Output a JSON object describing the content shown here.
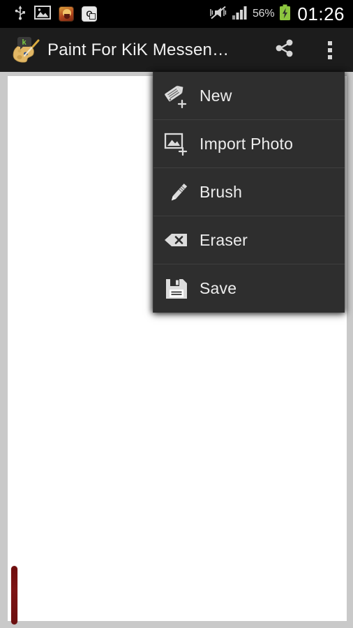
{
  "status_bar": {
    "left_icons": [
      {
        "name": "usb-icon",
        "label": "USB connected"
      },
      {
        "name": "gallery-icon",
        "label": "Screenshot captured"
      },
      {
        "name": "clash-of-clans-notification-icon",
        "label": "Clash of Clans"
      },
      {
        "name": "outlook-notification-icon",
        "label": "Outlook",
        "letter": "O"
      }
    ],
    "vibrate_icon": "vibrate-muted-icon",
    "signal_icon": "signal-bars-icon",
    "battery_percent": "56%",
    "battery_icon": "battery-charging-icon",
    "clock": "01:26"
  },
  "action_bar": {
    "app_icon": "paint-palette-kik-icon",
    "title": "Paint For KiK Messen…",
    "share_icon": "share-icon",
    "overflow_icon": "overflow-menu-icon"
  },
  "canvas": {
    "name": "drawing-canvas",
    "background_color": "#ffffff",
    "surround_color": "#c9c9c9",
    "strokes": [
      {
        "name": "red-brush-stroke",
        "color": "#6e0d0d"
      }
    ]
  },
  "menu": {
    "visible": true,
    "background_color": "#2e2e2e",
    "items": [
      {
        "id": "new",
        "label": "New",
        "icon": "new-note-plus-icon"
      },
      {
        "id": "import-photo",
        "label": "Import Photo",
        "icon": "image-plus-icon"
      },
      {
        "id": "brush",
        "label": "Brush",
        "icon": "pencil-icon"
      },
      {
        "id": "eraser",
        "label": "Eraser",
        "icon": "eraser-backspace-icon"
      },
      {
        "id": "save",
        "label": "Save",
        "icon": "floppy-disk-icon"
      }
    ]
  }
}
